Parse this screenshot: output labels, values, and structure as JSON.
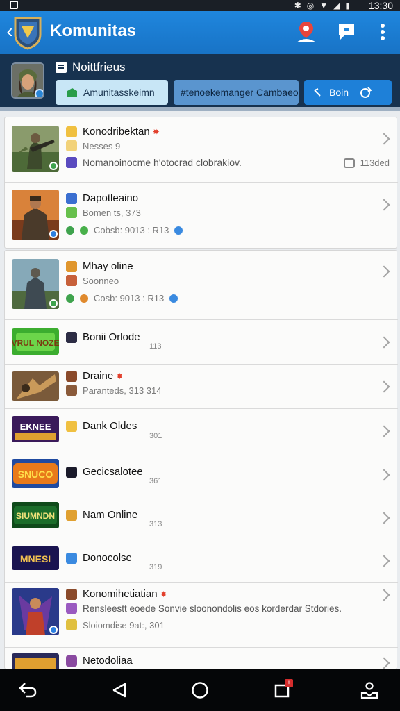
{
  "status_bar": {
    "time": "13:30"
  },
  "app_bar": {
    "title": "Komunitas"
  },
  "header": {
    "title": "Noittfrieus",
    "chips": [
      "Amunitasskeimn",
      "#tenoekemanger Cambaeo",
      "Boin"
    ]
  },
  "list": [
    {
      "name": "Konodribektan",
      "sub": "Nesses 9",
      "desc": "Nomanoinocme h'otocrad clobrakiov.",
      "count": "113ded"
    },
    {
      "name": "Dapotleaino",
      "sub": "Bomen ts, 373",
      "meta": "Cobsb: 9013 : R13"
    },
    {
      "name": "Mhay oline",
      "sub": "Soonneo",
      "meta": "Cosb: 9013 : R13"
    },
    {
      "name": "Bonii Orlode",
      "num": "113",
      "thumb_text": "VRUL NOZE"
    },
    {
      "name": "Draine",
      "sub": "Paranteds, 313 314"
    },
    {
      "name": "Dank Oldes",
      "num": "301",
      "thumb_text": "EKNEE"
    },
    {
      "name": "Gecicsalotee",
      "num": "361",
      "thumb_text": "SNUCO"
    },
    {
      "name": "Nam Online",
      "num": "313",
      "thumb_text": "SIUMNDN"
    },
    {
      "name": "Donocolse",
      "num": "319",
      "thumb_text": "MNESI"
    },
    {
      "name": "Konomihetiatian",
      "sub": "Rensleestt eoede Sonvie sloonondolis eos korderdar Stdories.",
      "sub2": "Sloiomdise 9at:, 301"
    },
    {
      "name": "Netodoliaa"
    }
  ],
  "colors": {
    "app_bar": "#1f86dd",
    "header_panel": "#17324f",
    "nav_bar": "#050608",
    "flame": "#e2402c"
  },
  "icons": [
    "back-arrow-icon",
    "app-shield-logo",
    "location-pin-icon",
    "chat-icon",
    "more-vert-icon",
    "navigation-back-icon",
    "triangle-back-icon",
    "home-circle-icon",
    "recents-square-icon",
    "profile-download-icon"
  ]
}
